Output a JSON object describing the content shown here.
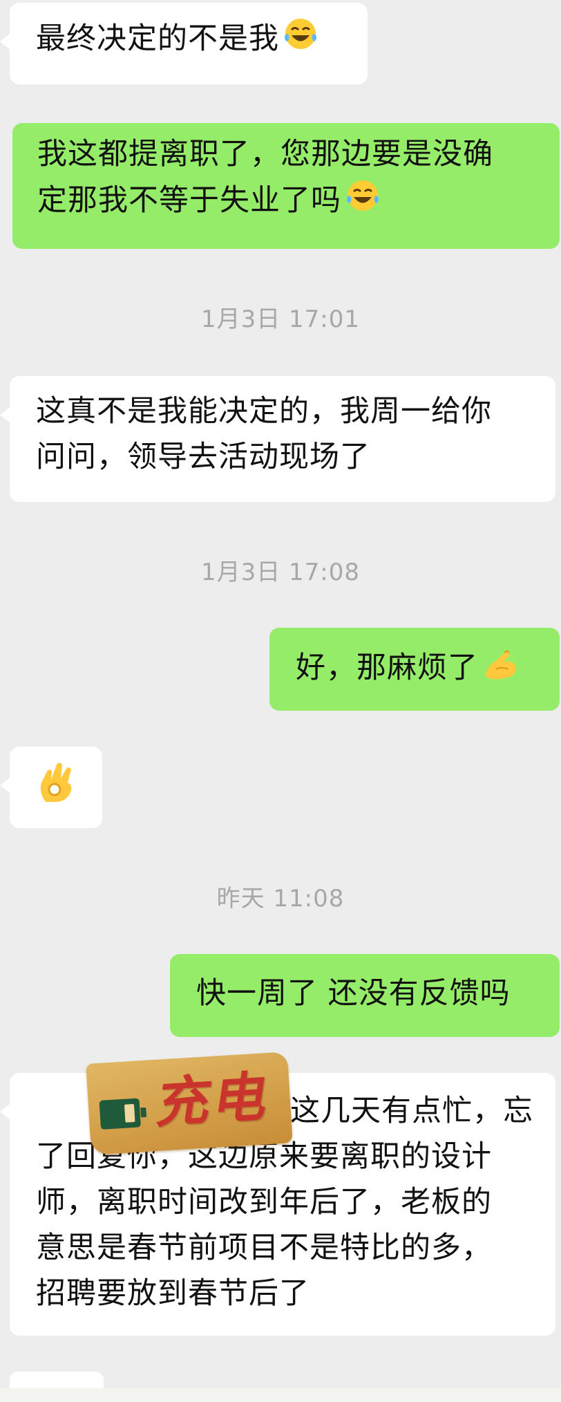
{
  "messages": {
    "m1": {
      "text": "最终决定的不是我",
      "emoji": "joy-tears-emoji"
    },
    "m2": {
      "line1": "我这都提离职了，您那边要是没确",
      "line2": "定那我不等于失业了吗",
      "emoji": "joy-tears-emoji"
    },
    "m3": {
      "line1": "这真不是我能决定的，我周一给你",
      "line2": "问问，领导去活动现场了"
    },
    "m4": {
      "text": "好，那麻烦了",
      "emoji": "pinching-hand-emoji"
    },
    "m5": {
      "emoji": "ok-hand-emoji"
    },
    "m6": {
      "text": "快一周了 还没有反馈吗"
    },
    "m7": {
      "lines": [
        "抱歉这几天有点忙，忘",
        "了回复你，这边原来要离职的设计",
        "师，离职时间改到年后了，老板的",
        "意思是春节前项目不是特比的多，",
        "招聘要放到春节后了"
      ]
    }
  },
  "timestamps": {
    "t1": "1月3日 17:01",
    "t2": "1月3日 17:08",
    "t3": "昨天 11:08"
  },
  "sticker": {
    "text": "充电"
  },
  "colors": {
    "background": "#ededed",
    "sent_bubble": "#95ec69",
    "received_bubble": "#ffffff",
    "timestamp_text": "#a7a7a7"
  }
}
